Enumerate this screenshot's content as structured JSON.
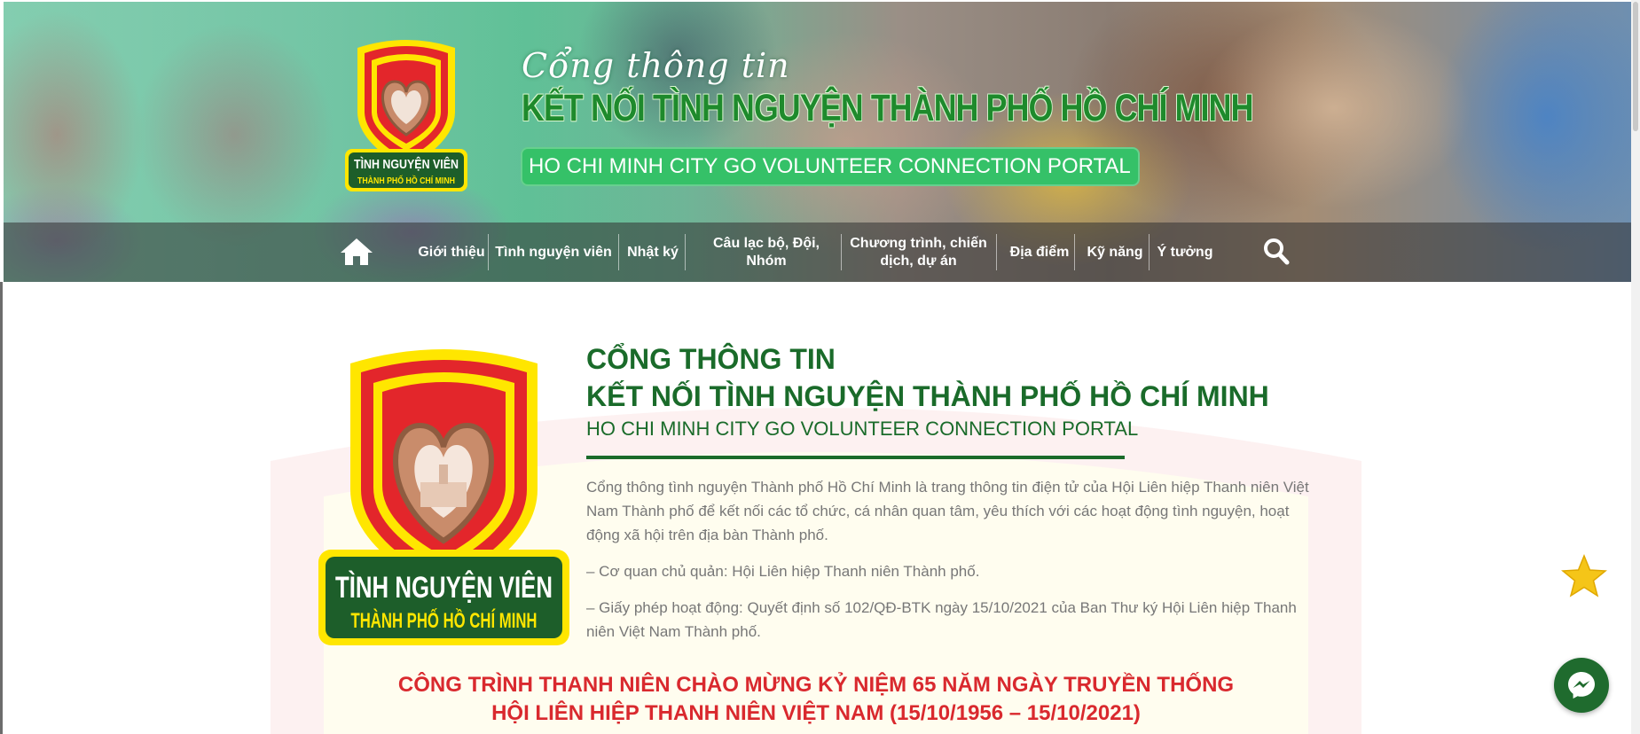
{
  "hero": {
    "script_title": "Cổng thông tin",
    "main_title": "KẾT NỐI TÌNH NGUYỆN THÀNH PHỐ HỒ CHÍ MINH",
    "english_title": "HO CHI MINH CITY GO VOLUNTEER CONNECTION PORTAL",
    "logo_line1": "TÌNH NGUYỆN VIÊN",
    "logo_line2": "THÀNH PHỐ HỒ CHÍ MINH"
  },
  "nav": {
    "home_icon": "home-icon",
    "items": [
      "Giới thiệu",
      "Tình nguyện viên",
      "Nhật ký",
      "Câu lạc bộ, Đội, Nhóm",
      "Chương trình, chiến dịch, dự án",
      "Địa điểm",
      "Kỹ năng",
      "Ý tưởng"
    ],
    "search_icon": "search-icon"
  },
  "intro": {
    "heading_line1": "CỔNG THÔNG TIN",
    "heading_line2": "KẾT NỐI TÌNH NGUYỆN THÀNH PHỐ HỒ CHÍ MINH",
    "english": "HO CHI MINH CITY GO VOLUNTEER CONNECTION PORTAL",
    "paragraph": "Cổng thông tình nguyện Thành phố Hồ Chí Minh là trang thông tin điện tử của Hội Liên hiệp Thanh niên Việt Nam Thành phố để kết nối các tổ chức, cá nhân quan tâm, yêu thích với các hoạt động tình nguyện, hoạt động xã hội trên địa bàn Thành phố.",
    "agency": "– Cơ quan chủ quản: Hội Liên hiệp Thanh niên Thành phố.",
    "license": "– Giấy phép hoạt động: Quyết định số 102/QĐ-BTK ngày 15/10/2021 của Ban Thư ký Hội Liên hiệp Thanh niên Việt Nam Thành phố."
  },
  "celebration": {
    "line1": "CÔNG TRÌNH THANH NIÊN CHÀO MỪNG KỶ NIỆM 65 NĂM NGÀY TRUYỀN THỐNG",
    "line2": "HỘI LIÊN HIỆP THANH NIÊN VIỆT NAM (15/10/1956 – 15/10/2021)"
  },
  "main_logo": {
    "line1": "TÌNH NGUYỆN VIÊN",
    "line2": "THÀNH PHỐ HỒ CHÍ MINH"
  },
  "widgets": {
    "star_icon": "star-icon",
    "messenger_icon": "messenger-icon"
  },
  "colors": {
    "brand_green": "#1a6b2a",
    "banner_green": "#35c168",
    "headline_red": "#d9292e",
    "body_gray": "#777777",
    "shield_red": "#e3262b",
    "shield_yellow": "#ffe600",
    "star_gold": "#f5c518"
  }
}
